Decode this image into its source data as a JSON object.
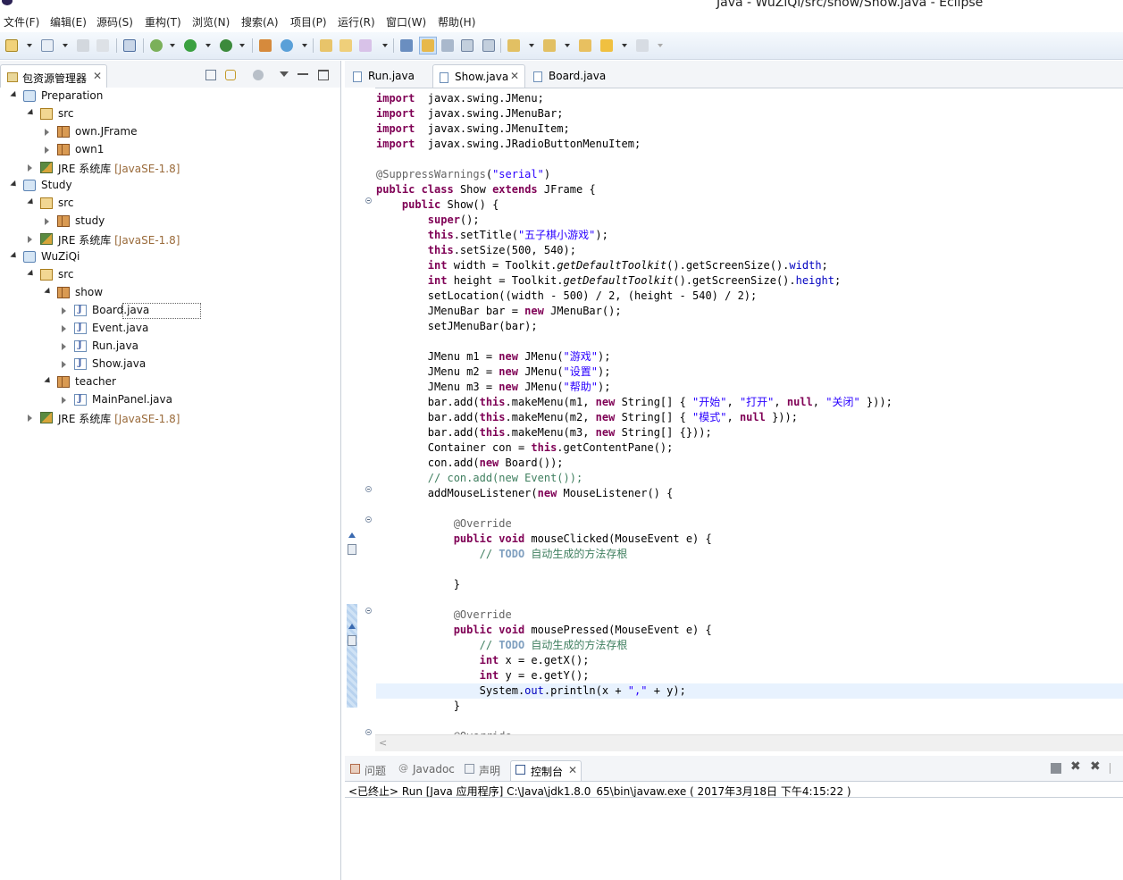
{
  "window": {
    "title": "Java - WuZiQi/src/show/Show.java - Eclipse"
  },
  "menu": [
    "文件(F)",
    "编辑(E)",
    "源码(S)",
    "重构(T)",
    "浏览(N)",
    "搜索(A)",
    "项目(P)",
    "运行(R)",
    "窗口(W)",
    "帮助(H)"
  ],
  "package_explorer": {
    "title": "包资源管理器",
    "tree": [
      {
        "label": "Preparation",
        "kind": "project",
        "level": 0,
        "open": true
      },
      {
        "label": "src",
        "kind": "src",
        "level": 1,
        "open": true
      },
      {
        "label": "own.JFrame",
        "kind": "package",
        "level": 2,
        "open": false
      },
      {
        "label": "own1",
        "kind": "package",
        "level": 2,
        "open": false
      },
      {
        "label": "JRE 系统库",
        "decoration": "[JavaSE-1.8]",
        "kind": "jre",
        "level": 1,
        "open": false
      },
      {
        "label": "Study",
        "kind": "project",
        "level": 0,
        "open": true
      },
      {
        "label": "src",
        "kind": "src",
        "level": 1,
        "open": true
      },
      {
        "label": "study",
        "kind": "package",
        "level": 2,
        "open": false
      },
      {
        "label": "JRE 系统库",
        "decoration": "[JavaSE-1.8]",
        "kind": "jre",
        "level": 1,
        "open": false
      },
      {
        "label": "WuZiQi",
        "kind": "project",
        "level": 0,
        "open": true
      },
      {
        "label": "src",
        "kind": "src",
        "level": 1,
        "open": true
      },
      {
        "label": "show",
        "kind": "package",
        "level": 2,
        "open": true
      },
      {
        "label": "Board.java",
        "kind": "java",
        "level": 3,
        "open": false,
        "selected": true
      },
      {
        "label": "Event.java",
        "kind": "java",
        "level": 3,
        "open": false
      },
      {
        "label": "Run.java",
        "kind": "java",
        "level": 3,
        "open": false
      },
      {
        "label": "Show.java",
        "kind": "java",
        "level": 3,
        "open": false
      },
      {
        "label": "teacher",
        "kind": "package",
        "level": 2,
        "open": true
      },
      {
        "label": "MainPanel.java",
        "kind": "java",
        "level": 3,
        "open": false
      },
      {
        "label": "JRE 系统库",
        "decoration": "[JavaSE-1.8]",
        "kind": "jre",
        "level": 1,
        "open": false
      }
    ]
  },
  "editor": {
    "tabs": [
      {
        "label": "Run.java",
        "active": false
      },
      {
        "label": "Show.java",
        "active": true
      },
      {
        "label": "Board.java",
        "active": false
      }
    ],
    "current_line": 39,
    "lines": [
      [
        [
          "k",
          "import"
        ],
        [
          "",
          "  javax.swing.JMenu;"
        ]
      ],
      [
        [
          "k",
          "import"
        ],
        [
          "",
          "  javax.swing.JMenuBar;"
        ]
      ],
      [
        [
          "k",
          "import"
        ],
        [
          "",
          "  javax.swing.JMenuItem;"
        ]
      ],
      [
        [
          "k",
          "import"
        ],
        [
          "",
          "  javax.swing.JRadioButtonMenuItem;"
        ]
      ],
      [],
      [
        [
          "a",
          "@SuppressWarnings"
        ],
        [
          "",
          "("
        ],
        [
          "s",
          "\"serial\""
        ],
        [
          "",
          ")"
        ]
      ],
      [
        [
          "k",
          "public"
        ],
        [
          "",
          " "
        ],
        [
          "k",
          "class"
        ],
        [
          "",
          " Show "
        ],
        [
          "k",
          "extends"
        ],
        [
          "",
          " JFrame {"
        ]
      ],
      [
        [
          "",
          "    "
        ],
        [
          "k",
          "public"
        ],
        [
          "",
          " Show() {"
        ]
      ],
      [
        [
          "",
          "        "
        ],
        [
          "k",
          "super"
        ],
        [
          "",
          "();"
        ]
      ],
      [
        [
          "",
          "        "
        ],
        [
          "k",
          "this"
        ],
        [
          "",
          ".setTitle("
        ],
        [
          "s",
          "\"五子棋小游戏\""
        ],
        [
          "",
          ");"
        ]
      ],
      [
        [
          "",
          "        "
        ],
        [
          "k",
          "this"
        ],
        [
          "",
          ".setSize(500, 540);"
        ]
      ],
      [
        [
          "",
          "        "
        ],
        [
          "k",
          "int"
        ],
        [
          "",
          " width = Toolkit."
        ],
        [
          "st",
          "getDefaultToolkit"
        ],
        [
          "",
          "().getScreenSize()."
        ],
        [
          "f",
          "width"
        ],
        [
          "",
          ";"
        ]
      ],
      [
        [
          "",
          "        "
        ],
        [
          "k",
          "int"
        ],
        [
          "",
          " height = Toolkit."
        ],
        [
          "st",
          "getDefaultToolkit"
        ],
        [
          "",
          "().getScreenSize()."
        ],
        [
          "f",
          "height"
        ],
        [
          "",
          ";"
        ]
      ],
      [
        [
          "",
          "        setLocation((width - 500) / 2, (height - 540) / 2);"
        ]
      ],
      [
        [
          "",
          "        JMenuBar bar = "
        ],
        [
          "k",
          "new"
        ],
        [
          "",
          " JMenuBar();"
        ]
      ],
      [
        [
          "",
          "        setJMenuBar(bar);"
        ]
      ],
      [],
      [
        [
          "",
          "        JMenu m1 = "
        ],
        [
          "k",
          "new"
        ],
        [
          "",
          " JMenu("
        ],
        [
          "s",
          "\"游戏\""
        ],
        [
          "",
          ");"
        ]
      ],
      [
        [
          "",
          "        JMenu m2 = "
        ],
        [
          "k",
          "new"
        ],
        [
          "",
          " JMenu("
        ],
        [
          "s",
          "\"设置\""
        ],
        [
          "",
          ");"
        ]
      ],
      [
        [
          "",
          "        JMenu m3 = "
        ],
        [
          "k",
          "new"
        ],
        [
          "",
          " JMenu("
        ],
        [
          "s",
          "\"帮助\""
        ],
        [
          "",
          ");"
        ]
      ],
      [
        [
          "",
          "        bar.add("
        ],
        [
          "k",
          "this"
        ],
        [
          "",
          ".makeMenu(m1, "
        ],
        [
          "k",
          "new"
        ],
        [
          "",
          " String[] { "
        ],
        [
          "s",
          "\"开始\""
        ],
        [
          "",
          ", "
        ],
        [
          "s",
          "\"打开\""
        ],
        [
          "",
          ", "
        ],
        [
          "k",
          "null"
        ],
        [
          "",
          ", "
        ],
        [
          "s",
          "\"关闭\""
        ],
        [
          "",
          " }));"
        ]
      ],
      [
        [
          "",
          "        bar.add("
        ],
        [
          "k",
          "this"
        ],
        [
          "",
          ".makeMenu(m2, "
        ],
        [
          "k",
          "new"
        ],
        [
          "",
          " String[] { "
        ],
        [
          "s",
          "\"模式\""
        ],
        [
          "",
          ", "
        ],
        [
          "k",
          "null"
        ],
        [
          "",
          " }));"
        ]
      ],
      [
        [
          "",
          "        bar.add("
        ],
        [
          "k",
          "this"
        ],
        [
          "",
          ".makeMenu(m3, "
        ],
        [
          "k",
          "new"
        ],
        [
          "",
          " String[] {}));"
        ]
      ],
      [
        [
          "",
          "        Container con = "
        ],
        [
          "k",
          "this"
        ],
        [
          "",
          ".getContentPane();"
        ]
      ],
      [
        [
          "",
          "        con.add("
        ],
        [
          "k",
          "new"
        ],
        [
          "",
          " Board());"
        ]
      ],
      [
        [
          "c",
          "        // con.add(new Event());"
        ]
      ],
      [
        [
          "",
          "        addMouseListener("
        ],
        [
          "k",
          "new"
        ],
        [
          "",
          " MouseListener() {"
        ]
      ],
      [],
      [
        [
          "a",
          "            @Override"
        ]
      ],
      [
        [
          "",
          "            "
        ],
        [
          "k",
          "public"
        ],
        [
          "",
          " "
        ],
        [
          "k",
          "void"
        ],
        [
          "",
          " mouseClicked(MouseEvent e) {"
        ]
      ],
      [
        [
          "c",
          "                // "
        ],
        [
          "todo",
          "TODO"
        ],
        [
          "c",
          " 自动生成的方法存根"
        ]
      ],
      [],
      [
        [
          "",
          "            }"
        ]
      ],
      [],
      [
        [
          "a",
          "            @Override"
        ]
      ],
      [
        [
          "",
          "            "
        ],
        [
          "k",
          "public"
        ],
        [
          "",
          " "
        ],
        [
          "k",
          "void"
        ],
        [
          "",
          " mousePressed(MouseEvent e) {"
        ]
      ],
      [
        [
          "c",
          "                // "
        ],
        [
          "todo",
          "TODO"
        ],
        [
          "c",
          " 自动生成的方法存根"
        ]
      ],
      [
        [
          "",
          "                "
        ],
        [
          "k",
          "int"
        ],
        [
          "",
          " x = e.getX();"
        ]
      ],
      [
        [
          "",
          "                "
        ],
        [
          "k",
          "int"
        ],
        [
          "",
          " y = e.getY();"
        ]
      ],
      [
        [
          "",
          "                System."
        ],
        [
          "f",
          "out"
        ],
        [
          "",
          ".println(x + "
        ],
        [
          "s",
          "\",\""
        ],
        [
          "",
          " + y);"
        ]
      ],
      [
        [
          "",
          "            }"
        ]
      ],
      [],
      [
        [
          "a",
          "            @Override"
        ]
      ]
    ]
  },
  "console": {
    "tabs": [
      {
        "label": "问题",
        "active": false
      },
      {
        "label": "Javadoc",
        "active": false
      },
      {
        "label": "声明",
        "active": false
      },
      {
        "label": "控制台",
        "active": true
      }
    ],
    "status": "<已终止> Run [Java 应用程序] C:\\Java\\jdk1.8.0_65\\bin\\javaw.exe ( 2017年3月18日 下午4:15:22 )"
  },
  "icons": {
    "project": "project-folder-icon",
    "src": "source-folder-icon",
    "package": "package-icon",
    "jre": "library-icon",
    "java": "java-file-icon"
  }
}
